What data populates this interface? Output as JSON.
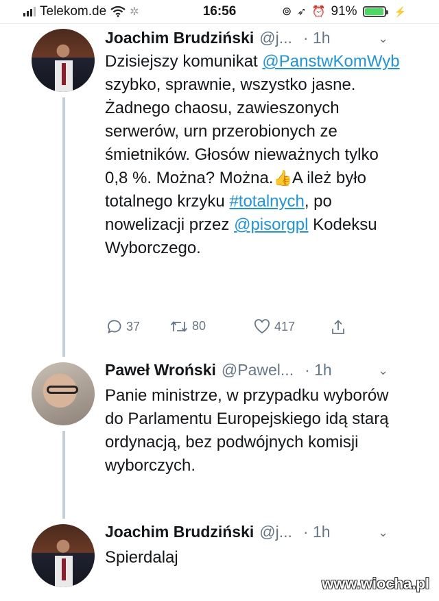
{
  "status_bar": {
    "carrier": "Telekom.de",
    "time": "16:56",
    "battery": "91%",
    "battery_level": 0.91
  },
  "tweets": [
    {
      "author": "Joachim Brudziński",
      "handle": "@j...",
      "time": "· 1h",
      "text_parts": [
        "Dzisiejszy komunikat ",
        "@PanstwKomWyb",
        " szybko, sprawnie, wszystko jasne. Żadnego chaosu, zawieszonych serwerów, urn przerobionych ze śmietników. Głosów nieważnych tylko 0,8 %. Można? Można.",
        "A ileż było totalnego krzyku ",
        "#totalnych",
        ", po nowelizacji przez ",
        "@pisorgpl",
        " Kodeksu Wyborczego."
      ],
      "replies": "37",
      "retweets": "80",
      "likes": "417"
    },
    {
      "author": "Paweł Wroński",
      "handle": "@Pawel...",
      "time": "· 1h",
      "text": "Panie ministrze, w przypadku wyborów do Parlamentu Europejskiego idą starą ordynacją, bez podwójnych komisji wyborczych."
    },
    {
      "author": "Joachim Brudziński",
      "handle": "@j...",
      "time": "· 1h",
      "text": "Spierdalaj"
    }
  ],
  "watermark": "www.wiocha.pl"
}
